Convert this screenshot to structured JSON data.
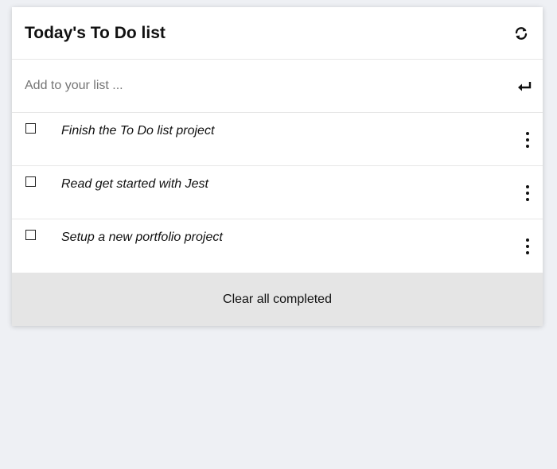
{
  "header": {
    "title": "Today's To Do list",
    "refresh_icon": "refresh-icon"
  },
  "add": {
    "placeholder": "Add to your list ...",
    "value": "",
    "enter_icon": "enter-icon"
  },
  "tasks": [
    {
      "text": "Finish the To Do list project",
      "completed": false
    },
    {
      "text": "Read get started with Jest",
      "completed": false
    },
    {
      "text": "Setup a new portfolio project",
      "completed": false
    }
  ],
  "footer": {
    "clear_label": "Clear all completed"
  },
  "colors": {
    "page_background": "#eef0f4",
    "card_background": "#ffffff",
    "footer_background": "#e5e5e5"
  }
}
